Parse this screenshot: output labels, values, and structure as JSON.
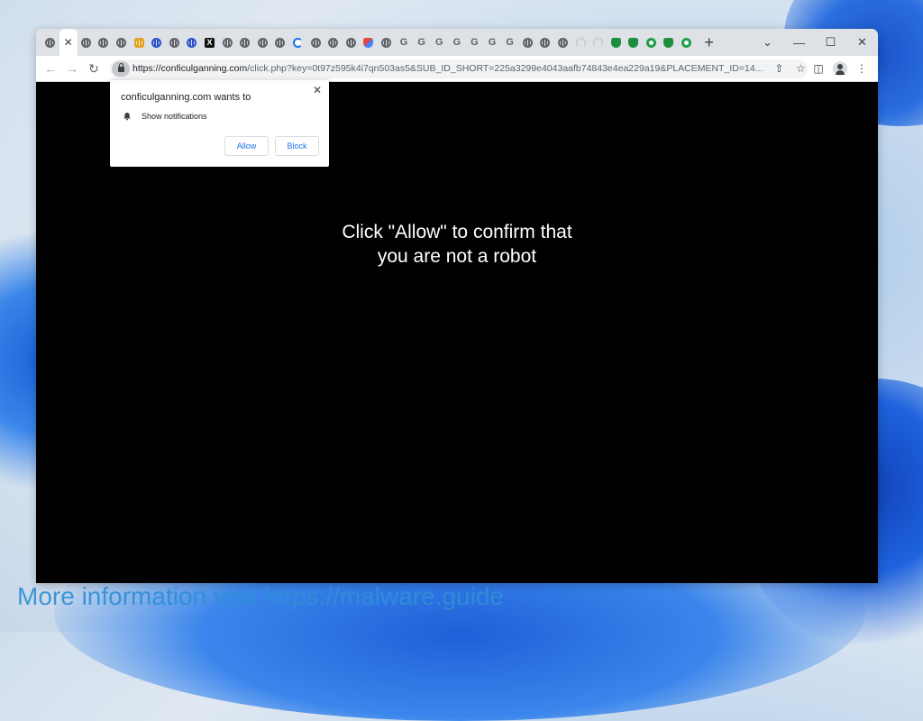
{
  "browser": {
    "tabs": [
      {
        "icon": "globe-icon"
      },
      {
        "icon": "close-icon",
        "active": true
      },
      {
        "icon": "globe-icon"
      },
      {
        "icon": "globe-icon"
      },
      {
        "icon": "globe-icon"
      },
      {
        "icon": "bell-icon"
      },
      {
        "icon": "globe-blue-icon"
      },
      {
        "icon": "globe-icon"
      },
      {
        "icon": "globe-blue-icon"
      },
      {
        "icon": "x-icon"
      },
      {
        "icon": "globe-icon"
      },
      {
        "icon": "globe-icon"
      },
      {
        "icon": "globe-icon"
      },
      {
        "icon": "globe-icon"
      },
      {
        "icon": "spinner-icon"
      },
      {
        "icon": "globe-icon"
      },
      {
        "icon": "globe-icon"
      },
      {
        "icon": "globe-icon"
      },
      {
        "icon": "heart-icon"
      },
      {
        "icon": "globe-icon"
      },
      {
        "icon": "google-icon"
      },
      {
        "icon": "google-icon"
      },
      {
        "icon": "google-icon"
      },
      {
        "icon": "google-icon"
      },
      {
        "icon": "google-icon"
      },
      {
        "icon": "google-icon"
      },
      {
        "icon": "google-icon"
      },
      {
        "icon": "globe-icon"
      },
      {
        "icon": "globe-icon"
      },
      {
        "icon": "globe-icon"
      },
      {
        "icon": "loading-icon"
      },
      {
        "icon": "loading-icon"
      },
      {
        "icon": "shield-icon"
      },
      {
        "icon": "shield-icon"
      },
      {
        "icon": "ring-icon"
      },
      {
        "icon": "shield-icon"
      },
      {
        "icon": "ring-icon"
      }
    ],
    "x_tab_glyph": "X",
    "google_glyph": "G",
    "new_tab_label": "+",
    "window_controls": {
      "chevron": "⌄",
      "minimize": "—",
      "maximize": "☐",
      "close": "✕"
    },
    "url_host": "https://conficulganning.com",
    "url_rest": "/click.php?key=0t97z595k4i7qn503as5&SUB_ID_SHORT=225a3299e4043aafb74843e4ea229a19&PLACEMENT_ID=14..."
  },
  "permission_popup": {
    "title": "conficulganning.com wants to",
    "item": "Show notifications",
    "allow_label": "Allow",
    "block_label": "Block",
    "close_label": "✕"
  },
  "page": {
    "headline_line1": "Click \"Allow\" to confirm that",
    "headline_line2": "you are not a robot"
  },
  "watermark": "More information visit https://malware.guide",
  "colors": {
    "accent": "#1a73e8",
    "page_bg": "#000000",
    "watermark": "#2f8fd4"
  }
}
